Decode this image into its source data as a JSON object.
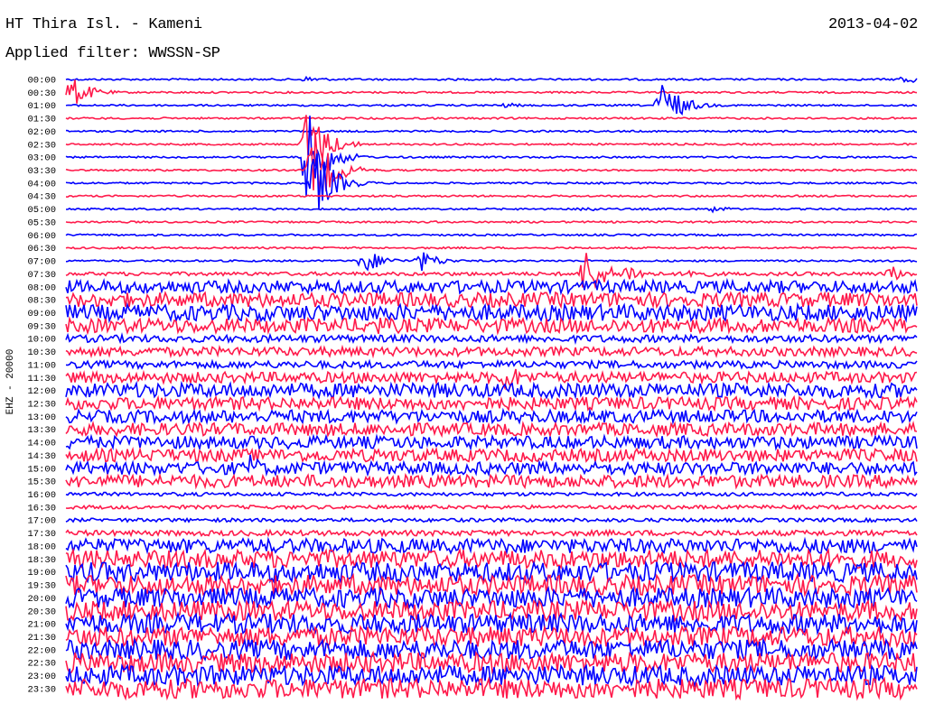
{
  "header": {
    "station": "HT Thira Isl. - Kameni",
    "date": "2013-04-02",
    "filter": "Applied filter: WWSSN-SP"
  },
  "chart_data": {
    "type": "line",
    "title": "HT Thira Isl. - Kameni",
    "subtitle": "Applied filter: WWSSN-SP",
    "date": "2013-04-02",
    "ylabel": "EHZ - 20000",
    "row_interval_minutes": 30,
    "colors": [
      "#0000ff",
      "#ff1a4b"
    ],
    "row_labels": [
      "00:00",
      "00:30",
      "01:00",
      "01:30",
      "02:00",
      "02:30",
      "03:00",
      "03:30",
      "04:00",
      "04:30",
      "05:00",
      "05:30",
      "06:00",
      "06:30",
      "07:00",
      "07:30",
      "08:00",
      "08:30",
      "09:00",
      "09:30",
      "10:00",
      "10:30",
      "11:00",
      "11:30",
      "12:00",
      "12:30",
      "13:00",
      "13:30",
      "14:00",
      "14:30",
      "15:00",
      "15:30",
      "16:00",
      "16:30",
      "17:00",
      "17:30",
      "18:00",
      "18:30",
      "19:00",
      "19:30",
      "20:00",
      "20:30",
      "21:00",
      "21:30",
      "22:00",
      "22:30",
      "23:00",
      "23:30"
    ],
    "noise_amplitude": [
      1,
      1,
      1,
      1,
      1,
      1,
      1,
      1,
      1,
      1,
      1,
      1,
      1,
      1,
      1,
      2,
      7,
      8,
      9,
      8,
      4,
      5,
      4,
      6,
      8,
      7,
      7,
      7,
      7,
      7,
      7,
      7,
      2,
      2,
      2,
      3,
      8,
      10,
      11,
      11,
      11,
      11,
      11,
      11,
      11,
      11,
      11,
      11
    ],
    "events": [
      {
        "row": 0,
        "minute": 8.5,
        "amplitude": 4
      },
      {
        "row": 0,
        "minute": 29.5,
        "amplitude": 6
      },
      {
        "row": 1,
        "minute": 0.2,
        "amplitude": 18
      },
      {
        "row": 2,
        "minute": 15.5,
        "amplitude": 3
      },
      {
        "row": 2,
        "minute": 21.0,
        "amplitude": 30
      },
      {
        "row": 5,
        "minute": 8.5,
        "amplitude": 45
      },
      {
        "row": 6,
        "minute": 8.5,
        "amplitude": 55
      },
      {
        "row": 7,
        "minute": 8.7,
        "amplitude": 50
      },
      {
        "row": 8,
        "minute": 8.8,
        "amplitude": 40
      },
      {
        "row": 10,
        "minute": 18.2,
        "amplitude": 4
      },
      {
        "row": 10,
        "minute": 22.8,
        "amplitude": 4
      },
      {
        "row": 14,
        "minute": 10.5,
        "amplitude": 15
      },
      {
        "row": 14,
        "minute": 12.5,
        "amplitude": 12
      },
      {
        "row": 15,
        "minute": 18.3,
        "amplitude": 30
      },
      {
        "row": 15,
        "minute": 19.8,
        "amplitude": 12
      },
      {
        "row": 15,
        "minute": 22.0,
        "amplitude": 8
      },
      {
        "row": 15,
        "minute": 29.0,
        "amplitude": 10
      },
      {
        "row": 19,
        "minute": 11.0,
        "amplitude": 12
      },
      {
        "row": 23,
        "minute": 15.5,
        "amplitude": 18
      },
      {
        "row": 30,
        "minute": 6.5,
        "amplitude": 16
      }
    ]
  }
}
